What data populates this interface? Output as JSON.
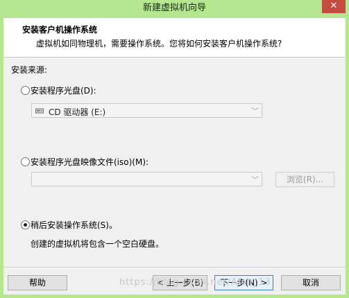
{
  "window": {
    "title": "新建虚拟机向导",
    "close_label": "✕"
  },
  "header": {
    "title": "安装客户机操作系统",
    "subtitle": "虚拟机如同物理机，需要操作系统。您将如何安装客户机操作系统?"
  },
  "source": {
    "label": "安装来源:",
    "disc": {
      "label": "安装程序光盘(D):",
      "selected": false,
      "drive": "CD 驱动器 (E:)"
    },
    "iso": {
      "label": "安装程序光盘映像文件(iso)(M):",
      "selected": false,
      "path": "",
      "browse_label": "浏览(R)..."
    },
    "later": {
      "label": "稍后安装操作系统(S)。",
      "selected": true,
      "description": "创建的虚拟机将包含一个空白硬盘。"
    }
  },
  "buttons": {
    "help": "帮助",
    "back": "< 上一步(B)",
    "next": "下一步(N) >",
    "cancel": "取消"
  },
  "watermark": "https://blog.csdn.net/Aish_13"
}
